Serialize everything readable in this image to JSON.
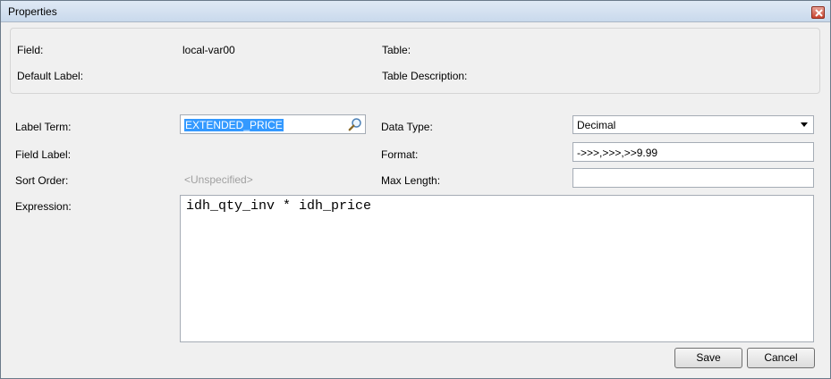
{
  "window": {
    "title": "Properties"
  },
  "info": {
    "field_label": "Field:",
    "field_value": "local-var00",
    "default_label_label": "Default Label:",
    "table_label": "Table:",
    "table_description_label": "Table Description:"
  },
  "form": {
    "label_term_label": "Label Term:",
    "label_term_value": "EXTENDED_PRICE",
    "field_label_label": "Field Label:",
    "sort_order_label": "Sort Order:",
    "sort_order_value": "<Unspecified>",
    "expression_label": "Expression:",
    "expression_value": "idh_qty_inv * idh_price",
    "data_type_label": "Data Type:",
    "data_type_value": "Decimal",
    "format_label": "Format:",
    "format_value": "->>>,>>>,>>9.99",
    "max_length_label": "Max Length:",
    "max_length_value": ""
  },
  "buttons": {
    "save": "Save",
    "cancel": "Cancel"
  },
  "icons": {
    "lookup": "magnifier-icon",
    "close": "close-icon",
    "dropdown": "chevron-down-icon"
  }
}
